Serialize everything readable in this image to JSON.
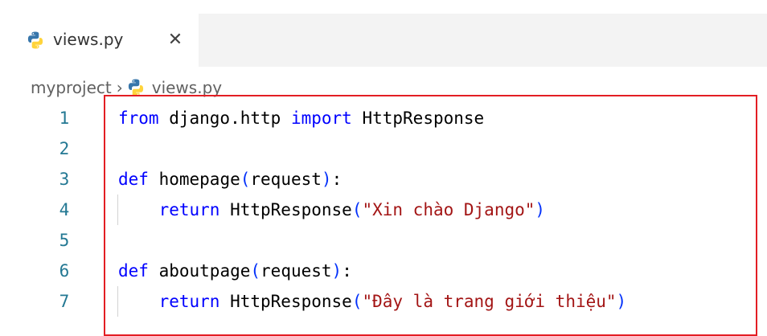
{
  "tab": {
    "label": "views.py",
    "close_glyph": "✕",
    "icon": "python-file-icon"
  },
  "breadcrumb": {
    "folder": "myproject",
    "separator": "›",
    "file": "views.py"
  },
  "editor": {
    "lines": [
      {
        "number": "1",
        "tokens": [
          {
            "t": "kw",
            "v": "from"
          },
          {
            "t": "pl",
            "v": " django.http "
          },
          {
            "t": "kw",
            "v": "import"
          },
          {
            "t": "pl",
            "v": " HttpResponse"
          }
        ]
      },
      {
        "number": "2",
        "tokens": []
      },
      {
        "number": "3",
        "tokens": [
          {
            "t": "kw",
            "v": "def"
          },
          {
            "t": "fn",
            "v": " homepage"
          },
          {
            "t": "par",
            "v": "("
          },
          {
            "t": "pl",
            "v": "request"
          },
          {
            "t": "par",
            "v": ")"
          },
          {
            "t": "pl",
            "v": ":"
          }
        ]
      },
      {
        "number": "4",
        "tokens": [
          {
            "t": "pl",
            "v": "    "
          },
          {
            "t": "kw",
            "v": "return"
          },
          {
            "t": "pl",
            "v": " HttpResponse"
          },
          {
            "t": "par",
            "v": "("
          },
          {
            "t": "str",
            "v": "\"Xin chào Django\""
          },
          {
            "t": "par",
            "v": ")"
          }
        ]
      },
      {
        "number": "5",
        "tokens": []
      },
      {
        "number": "6",
        "tokens": [
          {
            "t": "kw",
            "v": "def"
          },
          {
            "t": "fn",
            "v": " aboutpage"
          },
          {
            "t": "par",
            "v": "("
          },
          {
            "t": "pl",
            "v": "request"
          },
          {
            "t": "par",
            "v": ")"
          },
          {
            "t": "pl",
            "v": ":"
          }
        ]
      },
      {
        "number": "7",
        "tokens": [
          {
            "t": "pl",
            "v": "    "
          },
          {
            "t": "kw",
            "v": "return"
          },
          {
            "t": "pl",
            "v": " HttpResponse"
          },
          {
            "t": "par",
            "v": "("
          },
          {
            "t": "str",
            "v": "\"Đây là trang giới thiệu\""
          },
          {
            "t": "par",
            "v": ")"
          }
        ]
      }
    ]
  },
  "colors": {
    "keyword": "#0000ff",
    "string": "#a31515",
    "line_number": "#237893",
    "highlight_border": "#e31e24"
  }
}
